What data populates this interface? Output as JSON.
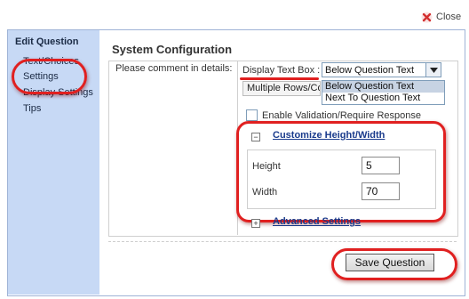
{
  "close": {
    "label": "Close",
    "icon": "close-icon",
    "icon_color": "#d32f2f"
  },
  "sidebar": {
    "title": "Edit Question",
    "items": [
      {
        "label": "Text/Choices"
      },
      {
        "label": "Settings"
      },
      {
        "label": "Display Settings"
      },
      {
        "label": "Tips"
      }
    ]
  },
  "main": {
    "title": "System Configuration",
    "comment_label": "Please comment in details:",
    "display_text_box": {
      "label": "Display Text Box :",
      "selected": "Below Question Text",
      "options": [
        "Below Question Text",
        "Next To Question Text"
      ]
    },
    "rows_box_text": "Multiple Rows/Co",
    "validation_label": "Enable Validation/Require Response",
    "customize": {
      "expander": "−",
      "title": "Customize Height/Width",
      "height_label": "Height",
      "height_value": "5",
      "width_label": "Width",
      "width_value": "70"
    },
    "advanced": {
      "expander": "+",
      "title": "Advanced Settings"
    }
  },
  "save_button": {
    "label": "Save Question"
  },
  "colors": {
    "sidebar_bg": "#c7d9f5",
    "highlight_red": "#e02020",
    "link_blue": "#1a3b8c"
  }
}
